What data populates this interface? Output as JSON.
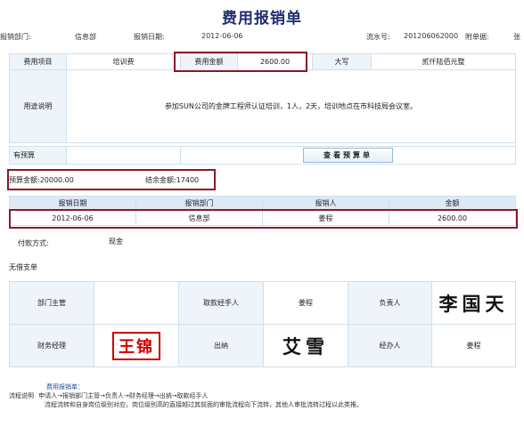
{
  "title": "费用报销单",
  "meta": {
    "dept_label": "报销部门:",
    "dept_value": "信息部",
    "date_label": "报销日期:",
    "date_value": "2012-06-06",
    "serial_label": "流水号:",
    "serial_value": "201206062000",
    "attach_label": "附单据:",
    "attach_value": "张"
  },
  "main": {
    "item_label": "费用项目",
    "item_value": "培训费",
    "amount_label": "费用金额",
    "amount_value": "2600.00",
    "upper_label": "大写",
    "upper_value": "贰仟陆佰元整",
    "purpose_label": "用途说明",
    "purpose_text": "参加SUN公司的金牌工程师认证培训，1人，2天，培训地点在市科技局会议室。"
  },
  "budget": {
    "label": "有预算",
    "button_label": "查看预算单",
    "budget_amount": "预算金额:20000.00",
    "balance_amount": "结余金额:17400"
  },
  "detail": {
    "headers": [
      "报销日期",
      "报销部门",
      "报销人",
      "金额"
    ],
    "row": [
      "2012-06-06",
      "信息部",
      "姜程",
      "2600.00"
    ]
  },
  "payment": {
    "label": "付款方式:",
    "value": "现金"
  },
  "borrow_label": "无借支单",
  "signatures": {
    "dept_head_label": "部门主管",
    "dept_head_value": "",
    "agent_label": "取款经手人",
    "agent_value": "姜程",
    "principal_label": "负责人",
    "principal_signature": "李国天",
    "finance_label": "财务经理",
    "finance_signature": "王锦",
    "cashier_label": "出纳",
    "cashier_signature": "艾雪",
    "handler_label": "经办人",
    "handler_value": "姜程"
  },
  "flow": {
    "title": "费用报销单：",
    "label": "流程说明",
    "line1": "申请人→报销部门主管→负责人→财务经理→出纳→取款经手人",
    "line2": "流程流转和自身岗位级别对应，岗位级别高的直接越过其前面的审批流程向下流转，其他人审批流转过程以此类推。"
  },
  "colors": {
    "title": "#1f2e6e",
    "header_bg": "#dde9f5",
    "border": "#cfe0ef",
    "highlight_box": "#8a1a2a",
    "stamp": "#cc0000"
  }
}
